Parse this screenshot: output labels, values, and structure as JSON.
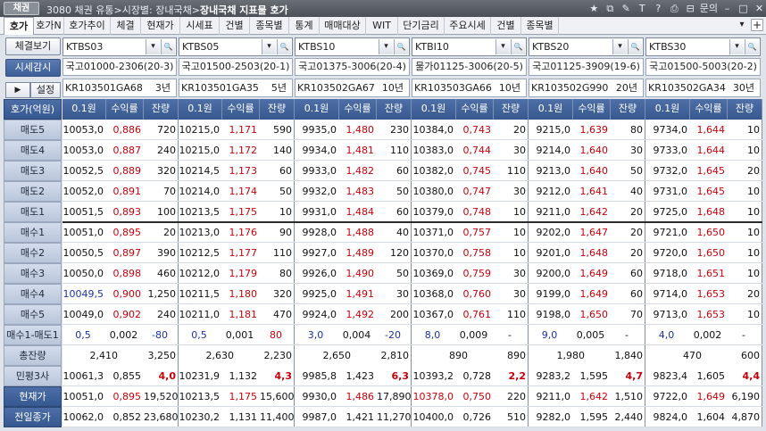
{
  "titlebar": {
    "icon_label": "채권",
    "screen_no": "3080",
    "title_path": "채권 유통>시장별: 장내국채>",
    "title_main": "장내국채 지표물 호가",
    "menu_label": "문의"
  },
  "tabs": [
    "호가",
    "호가N",
    "호가추이",
    "체결",
    "현재가",
    "시세표",
    "건별",
    "종목별",
    "통계",
    "매매대상",
    "WIT",
    "단기금리",
    "주요시세",
    "건별",
    "종목별"
  ],
  "left": {
    "btn_exec": "체결보기",
    "btn_monitor": "시세감시",
    "btn_play": "▶",
    "btn_setting": "설정",
    "row_labels": [
      "호가(억원)",
      "매도5",
      "매도4",
      "매도3",
      "매도2",
      "매도1",
      "매수1",
      "매수2",
      "매수3",
      "매수4",
      "매수5",
      "매수1-매도1",
      "총잔량",
      "민평3사",
      "현재가",
      "전일종가"
    ]
  },
  "col_headers": [
    "0.1원",
    "수익률",
    "잔량"
  ],
  "colors": {
    "red": "#c8000a",
    "blue": "#1b32a8",
    "header": "#4e6fa7",
    "highlight": "#cbe3f7"
  },
  "columns": [
    {
      "code": "KTBS03",
      "name": "국고01000-2306(20-3)",
      "isin": "KR103501GA68",
      "term": "3년",
      "rows": [
        [
          "10053,0",
          "0,886",
          "720"
        ],
        [
          "10053,0",
          "0,887",
          "240"
        ],
        [
          "10052,5",
          "0,889",
          "320"
        ],
        [
          "10052,0",
          "0,891",
          "70"
        ],
        [
          "10051,5",
          "0,893",
          "100"
        ],
        [
          "10051,0",
          "0,895",
          "20"
        ],
        [
          "10050,5",
          "0,897",
          "390"
        ],
        [
          "10050,0",
          "0,898",
          "460"
        ],
        [
          "10049,5",
          "0,900",
          "1,250"
        ],
        [
          "10049,0",
          "0,902",
          "240"
        ],
        [
          "0,5",
          "0,002",
          "-80"
        ]
      ],
      "total": [
        "2,410",
        "3,250"
      ],
      "minpyeong": [
        "10061,3",
        "0,855",
        "4,0"
      ],
      "current": [
        "10051,0",
        "0,895",
        "19,520"
      ],
      "prev": [
        "10062,0",
        "0,852",
        "23,680"
      ]
    },
    {
      "code": "KTBS05",
      "name": "국고01500-2503(20-1)",
      "isin": "KR103501GA35",
      "term": "5년",
      "rows": [
        [
          "10215,0",
          "1,171",
          "590"
        ],
        [
          "10215,0",
          "1,172",
          "140"
        ],
        [
          "10214,5",
          "1,173",
          "60"
        ],
        [
          "10214,0",
          "1,174",
          "50"
        ],
        [
          "10213,5",
          "1,175",
          "10"
        ],
        [
          "10213,0",
          "1,176",
          "90"
        ],
        [
          "10212,5",
          "1,177",
          "110"
        ],
        [
          "10212,0",
          "1,179",
          "80"
        ],
        [
          "10211,5",
          "1,180",
          "320"
        ],
        [
          "10211,0",
          "1,181",
          "470"
        ],
        [
          "0,5",
          "0,001",
          "80"
        ]
      ],
      "total": [
        "2,630",
        "2,230"
      ],
      "minpyeong": [
        "10231,9",
        "1,132",
        "4,3"
      ],
      "current": [
        "10213,5",
        "1,175",
        "15,600"
      ],
      "prev": [
        "10230,2",
        "1,131",
        "11,400"
      ]
    },
    {
      "code": "KTBS10",
      "name": "국고01375-3006(20-4)",
      "isin": "KR103502GA67",
      "term": "10년",
      "rows": [
        [
          "9935,0",
          "1,480",
          "230"
        ],
        [
          "9934,0",
          "1,481",
          "110"
        ],
        [
          "9933,0",
          "1,482",
          "60"
        ],
        [
          "9932,0",
          "1,483",
          "50"
        ],
        [
          "9931,0",
          "1,484",
          "60"
        ],
        [
          "9928,0",
          "1,488",
          "40"
        ],
        [
          "9927,0",
          "1,489",
          "120"
        ],
        [
          "9926,0",
          "1,490",
          "50"
        ],
        [
          "9925,0",
          "1,491",
          "30"
        ],
        [
          "9924,0",
          "1,492",
          "200"
        ],
        [
          "3,0",
          "0,004",
          "-20"
        ]
      ],
      "total": [
        "2,650",
        "2,810"
      ],
      "minpyeong": [
        "9985,8",
        "1,423",
        "6,3"
      ],
      "current": [
        "9930,0",
        "1,486",
        "17,890"
      ],
      "prev": [
        "9987,0",
        "1,421",
        "11,270"
      ]
    },
    {
      "code": "KTBI10",
      "name": "물가01125-3006(20-5)",
      "isin": "KR103503GA66",
      "term": "10년",
      "rows": [
        [
          "10384,0",
          "0,743",
          "20"
        ],
        [
          "10383,0",
          "0,744",
          "30"
        ],
        [
          "10382,0",
          "0,745",
          "110"
        ],
        [
          "10380,0",
          "0,747",
          "30"
        ],
        [
          "10379,0",
          "0,748",
          "10"
        ],
        [
          "10371,0",
          "0,757",
          "10"
        ],
        [
          "10370,0",
          "0,758",
          "10"
        ],
        [
          "10369,0",
          "0,759",
          "30"
        ],
        [
          "10368,0",
          "0,760",
          "30"
        ],
        [
          "10367,0",
          "0,761",
          "110"
        ],
        [
          "8,0",
          "0,009",
          "-"
        ]
      ],
      "total": [
        "890",
        "890"
      ],
      "minpyeong": [
        "10393,2",
        "0,728",
        "2,2"
      ],
      "current": [
        "10378,0",
        "0,750",
        "220"
      ],
      "prev": [
        "10400,0",
        "0,726",
        "510"
      ]
    },
    {
      "code": "KTBS20",
      "name": "국고01125-3909(19-6)",
      "isin": "KR103502G990",
      "term": "20년",
      "rows": [
        [
          "9215,0",
          "1,639",
          "80"
        ],
        [
          "9214,0",
          "1,640",
          "30"
        ],
        [
          "9213,0",
          "1,640",
          "50"
        ],
        [
          "9212,0",
          "1,641",
          "40"
        ],
        [
          "9211,0",
          "1,642",
          "20"
        ],
        [
          "9202,0",
          "1,647",
          "20"
        ],
        [
          "9201,0",
          "1,648",
          "20"
        ],
        [
          "9200,0",
          "1,649",
          "60"
        ],
        [
          "9199,0",
          "1,649",
          "60"
        ],
        [
          "9198,0",
          "1,650",
          "70"
        ],
        [
          "9,0",
          "0,005",
          "-"
        ]
      ],
      "total": [
        "1,980",
        "1,840"
      ],
      "minpyeong": [
        "9283,2",
        "1,595",
        "4,7"
      ],
      "current": [
        "9211,0",
        "1,642",
        "1,510"
      ],
      "prev": [
        "9282,0",
        "1,595",
        "2,440"
      ]
    },
    {
      "code": "KTBS30",
      "name": "국고01500-5003(20-2)",
      "isin": "KR103502GA34",
      "term": "30년",
      "rows": [
        [
          "9734,0",
          "1,644",
          "10"
        ],
        [
          "9733,0",
          "1,644",
          "10"
        ],
        [
          "9732,0",
          "1,645",
          "20"
        ],
        [
          "9731,0",
          "1,645",
          "10"
        ],
        [
          "9725,0",
          "1,648",
          "10"
        ],
        [
          "9721,0",
          "1,650",
          "10"
        ],
        [
          "9720,0",
          "1,650",
          "10"
        ],
        [
          "9718,0",
          "1,651",
          "10"
        ],
        [
          "9714,0",
          "1,653",
          "20"
        ],
        [
          "9713,0",
          "1,653",
          "10"
        ],
        [
          "4,0",
          "0,002",
          "-"
        ]
      ],
      "total": [
        "470",
        "600"
      ],
      "minpyeong": [
        "9823,4",
        "1,605",
        "4,4"
      ],
      "current": [
        "9722,0",
        "1,649",
        "6,190"
      ],
      "prev": [
        "9824,0",
        "1,604",
        "4,870"
      ]
    }
  ]
}
